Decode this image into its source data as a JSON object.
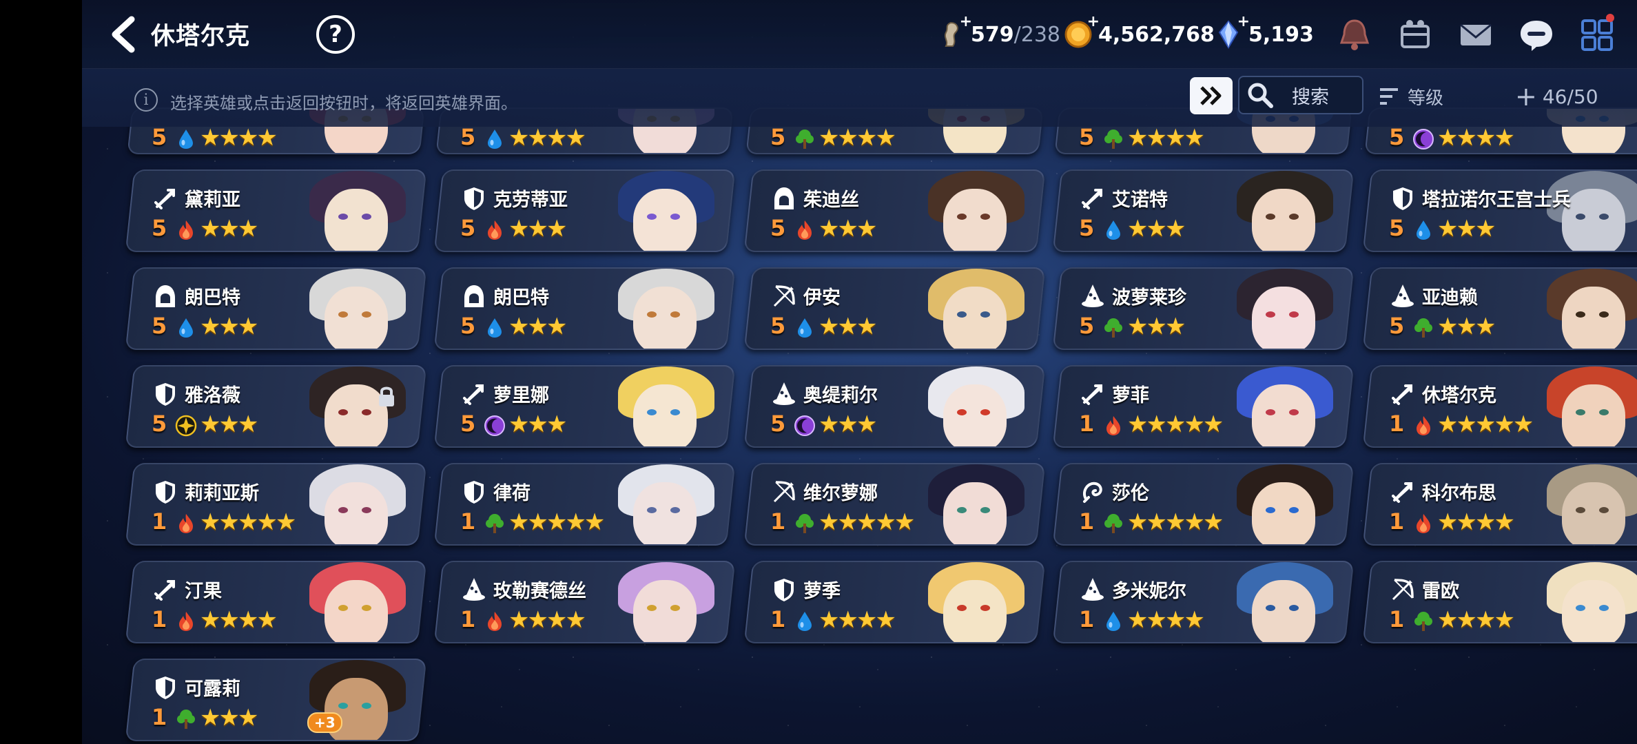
{
  "header": {
    "title": "休塔尔克",
    "help_icon": "question-circle-icon",
    "back_icon": "chevron-left-icon"
  },
  "currencies": {
    "stamina": {
      "current": "579",
      "max": "/238",
      "icon": "stamina-icon"
    },
    "gold": {
      "value": "4,562,768",
      "icon": "gold-coin-icon"
    },
    "crystal": {
      "value": "5,193",
      "icon": "crystal-icon"
    }
  },
  "top_icons": [
    "bell-icon",
    "hero-list-icon",
    "mail-icon",
    "chat-icon",
    "grid-menu-icon"
  ],
  "info_bar": {
    "hint": "选择英雄或点击返回按钮时，将返回英雄界面。",
    "search_label": "搜索",
    "sort_label": "等级",
    "capacity": "46/50"
  },
  "colors": {
    "level": "#ff9a3a",
    "star": "#ffc934",
    "fire": "#e8462a",
    "water": "#1e8fe8",
    "earth": "#3fae2e",
    "dark": "#8a3fd6",
    "light": "#f0c020"
  },
  "partial_row": [
    {
      "level": "5",
      "element": "water",
      "stars": "★★★★"
    },
    {
      "level": "5",
      "element": "water",
      "stars": "★★★★"
    },
    {
      "level": "5",
      "element": "earth",
      "stars": "★★★★"
    },
    {
      "level": "5",
      "element": "earth",
      "stars": "★★★★"
    },
    {
      "level": "5",
      "element": "dark",
      "stars": "★★★★"
    }
  ],
  "heroes": [
    {
      "name": "黛莉亚",
      "class": "sword",
      "level": "5",
      "element": "fire",
      "stars": "★★★"
    },
    {
      "name": "克劳蒂亚",
      "class": "shield",
      "level": "5",
      "element": "fire",
      "stars": "★★★"
    },
    {
      "name": "茱迪丝",
      "class": "hood",
      "level": "5",
      "element": "fire",
      "stars": "★★★"
    },
    {
      "name": "艾诺特",
      "class": "sword",
      "level": "5",
      "element": "water",
      "stars": "★★★"
    },
    {
      "name": "塔拉诺尔王宫士兵",
      "class": "shield",
      "level": "5",
      "element": "water",
      "stars": "★★★"
    },
    {
      "name": "朗巴特",
      "class": "hood",
      "level": "5",
      "element": "water",
      "stars": "★★★"
    },
    {
      "name": "朗巴特",
      "class": "hood",
      "level": "5",
      "element": "water",
      "stars": "★★★"
    },
    {
      "name": "伊安",
      "class": "bow",
      "level": "5",
      "element": "water",
      "stars": "★★★"
    },
    {
      "name": "波萝莱珍",
      "class": "mage",
      "level": "5",
      "element": "earth",
      "stars": "★★★"
    },
    {
      "name": "亚迪赖",
      "class": "mage",
      "level": "5",
      "element": "earth",
      "stars": "★★★"
    },
    {
      "name": "雅洛薇",
      "class": "shield",
      "level": "5",
      "element": "light",
      "stars": "★★★",
      "locked": true
    },
    {
      "name": "萝里娜",
      "class": "sword",
      "level": "5",
      "element": "dark",
      "stars": "★★★"
    },
    {
      "name": "奥缇莉尔",
      "class": "mage",
      "level": "5",
      "element": "dark",
      "stars": "★★★"
    },
    {
      "name": "萝菲",
      "class": "sword",
      "level": "1",
      "element": "fire",
      "stars": "★★★★★"
    },
    {
      "name": "休塔尔克",
      "class": "sword",
      "level": "1",
      "element": "fire",
      "stars": "★★★★★"
    },
    {
      "name": "莉莉亚斯",
      "class": "shield",
      "level": "1",
      "element": "fire",
      "stars": "★★★★★"
    },
    {
      "name": "律荷",
      "class": "shield",
      "level": "1",
      "element": "earth",
      "stars": "★★★★★"
    },
    {
      "name": "维尔萝娜",
      "class": "bow",
      "level": "1",
      "element": "earth",
      "stars": "★★★★★"
    },
    {
      "name": "莎伦",
      "class": "spirit",
      "level": "1",
      "element": "earth",
      "stars": "★★★★★"
    },
    {
      "name": "科尔布思",
      "class": "sword",
      "level": "1",
      "element": "fire",
      "stars": "★★★★"
    },
    {
      "name": "汀果",
      "class": "sword",
      "level": "1",
      "element": "fire",
      "stars": "★★★★"
    },
    {
      "name": "玫勒赛德丝",
      "class": "mage",
      "level": "1",
      "element": "fire",
      "stars": "★★★★"
    },
    {
      "name": "萝季",
      "class": "shield",
      "level": "1",
      "element": "water",
      "stars": "★★★★"
    },
    {
      "name": "多米妮尔",
      "class": "mage",
      "level": "1",
      "element": "water",
      "stars": "★★★★"
    },
    {
      "name": "雷欧",
      "class": "bow",
      "level": "1",
      "element": "earth",
      "stars": "★★★★"
    },
    {
      "name": "可露莉",
      "class": "shield",
      "level": "1",
      "element": "earth",
      "stars": "★★★",
      "badge": "+3"
    }
  ]
}
